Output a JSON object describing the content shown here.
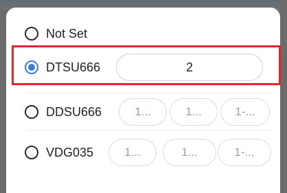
{
  "options": [
    {
      "label": "Not Set",
      "selected": false
    },
    {
      "label": "DTSU666",
      "selected": true,
      "value": "2"
    },
    {
      "label": "DDSU666",
      "selected": false,
      "fields": [
        "1...",
        "1...",
        "1-..."
      ]
    },
    {
      "label": "VDG035",
      "selected": false,
      "fields": [
        "1...",
        "1...",
        "1-..."
      ]
    }
  ],
  "colors": {
    "accent": "#3a7be0",
    "highlight_border": "#e8232c",
    "backdrop": "#6b6b6b"
  }
}
